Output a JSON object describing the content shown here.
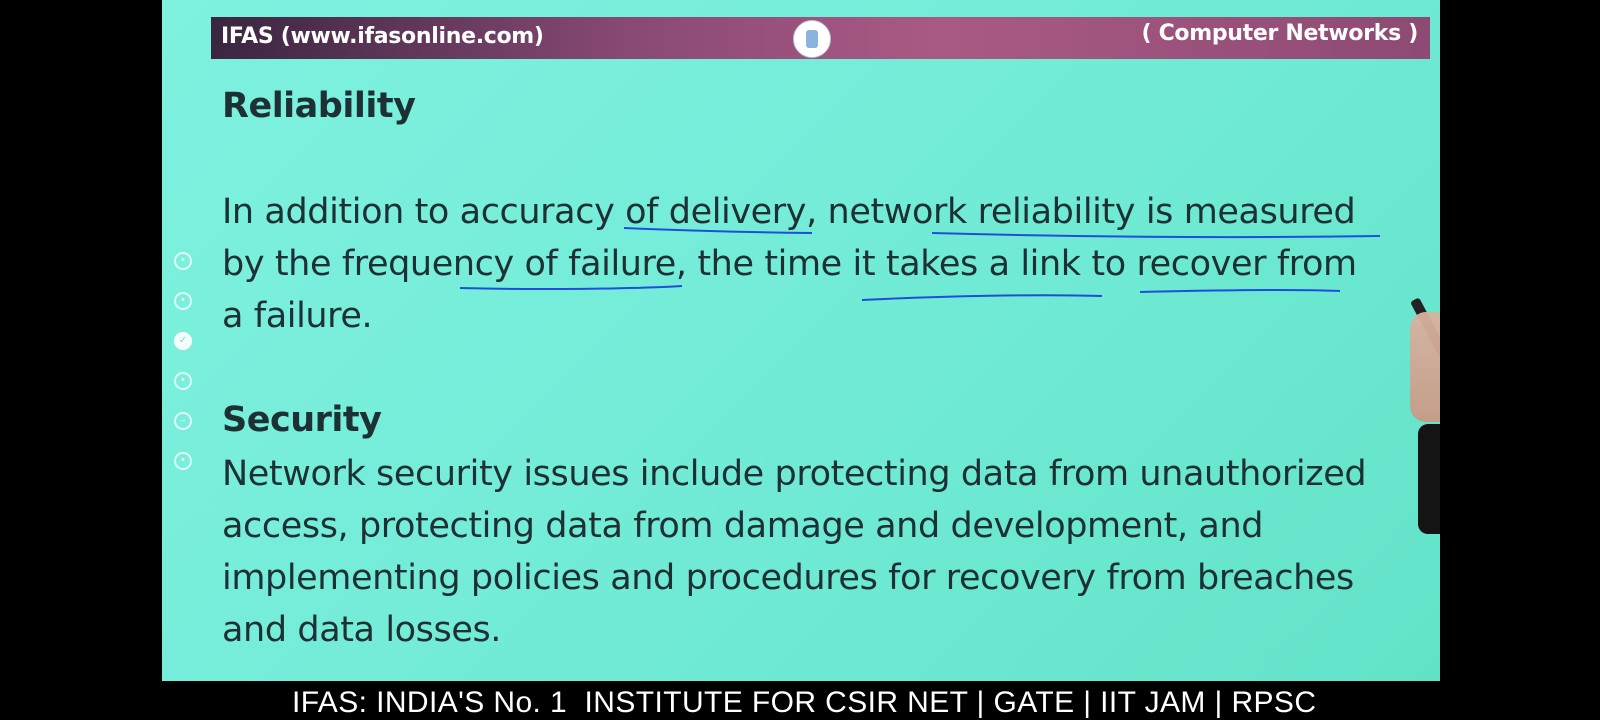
{
  "header": {
    "left_text": "IFAS (www.ifasonline.com)",
    "right_text": "( Computer Networks )",
    "logo_icon": "ifas-logo-icon"
  },
  "slide": {
    "reliability": {
      "title": "Reliability",
      "body": "In addition to accuracy of delivery, network reliability is measured\nby the frequency of failure, the time it takes a link to recover from\na failure."
    },
    "security": {
      "title": "Security",
      "body": "Network security issues include protecting data from unauthorized\naccess, protecting data from damage and development, and\nimplementing policies and procedures for recovery from breaches\nand data losses."
    }
  },
  "toolbar": {
    "icons": [
      "select-tool-icon",
      "pointer-tool-icon",
      "pen-tool-icon",
      "highlighter-tool-icon",
      "eraser-tool-icon",
      "color-tool-icon"
    ]
  },
  "ticker": {
    "text": "IFAS: INDIA'S No. 1  INSTITUTE FOR CSIR NET | GATE | IIT JAM | RPSC"
  },
  "colors": {
    "slide_background": "#74ecd8",
    "header_bar": "#8a4a76",
    "annotation_ink": "#1f4fd9",
    "text": "#1d3034"
  }
}
